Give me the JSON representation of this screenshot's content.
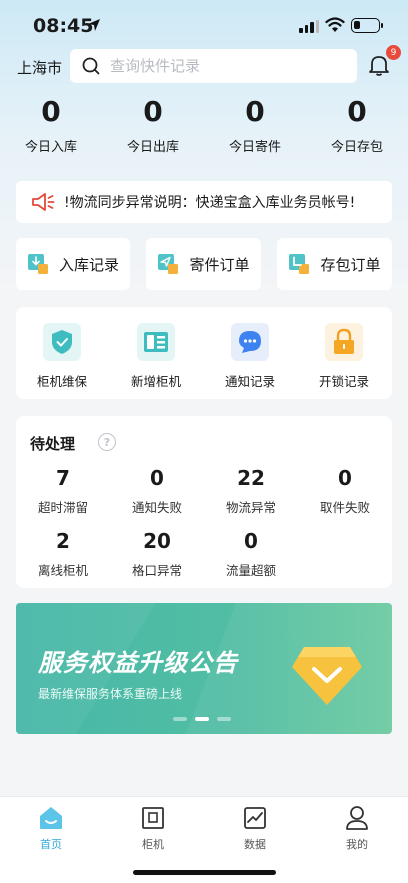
{
  "status_bar": {
    "time": "08:45"
  },
  "header": {
    "city": "上海市",
    "search_placeholder": "查询快件记录",
    "notification_count": "9"
  },
  "stats": [
    {
      "value": "0",
      "label": "今日入库"
    },
    {
      "value": "0",
      "label": "今日出库"
    },
    {
      "value": "0",
      "label": "今日寄件"
    },
    {
      "value": "0",
      "label": "今日存包"
    }
  ],
  "notice": {
    "text": "!物流同步异常说明：快递宝盒入库业务员帐号!"
  },
  "quick_actions": [
    {
      "label": "入库记录",
      "icon": "inbound-record-icon"
    },
    {
      "label": "寄件订单",
      "icon": "send-order-icon"
    },
    {
      "label": "存包订单",
      "icon": "storage-order-icon"
    }
  ],
  "menu": [
    {
      "label": "柜机维保",
      "icon": "shield-check-icon"
    },
    {
      "label": "新增柜机",
      "icon": "cabinet-add-icon"
    },
    {
      "label": "通知记录",
      "icon": "message-icon"
    },
    {
      "label": "开锁记录",
      "icon": "lock-icon"
    }
  ],
  "pending": {
    "title": "待处理",
    "help": "?",
    "items": [
      {
        "value": "7",
        "label": "超时滞留"
      },
      {
        "value": "0",
        "label": "通知失败"
      },
      {
        "value": "22",
        "label": "物流异常"
      },
      {
        "value": "0",
        "label": "取件失败"
      },
      {
        "value": "2",
        "label": "离线柜机"
      },
      {
        "value": "20",
        "label": "格口异常"
      },
      {
        "value": "0",
        "label": "流量超额"
      }
    ]
  },
  "banner": {
    "title": "服务权益升级公告",
    "subtitle": "最新维保服务体系重磅上线",
    "active_slide": 2,
    "slide_count": 3
  },
  "tabbar": [
    {
      "label": "首页",
      "icon": "home-icon",
      "active": true
    },
    {
      "label": "柜机",
      "icon": "cabinet-icon",
      "active": false
    },
    {
      "label": "数据",
      "icon": "chart-icon",
      "active": false
    },
    {
      "label": "我的",
      "icon": "user-icon",
      "active": false
    }
  ],
  "colors": {
    "accent": "#2fa8d8",
    "badge": "#e84a3c",
    "banner": "#4fbba5",
    "alert_red": "#e5483b"
  }
}
